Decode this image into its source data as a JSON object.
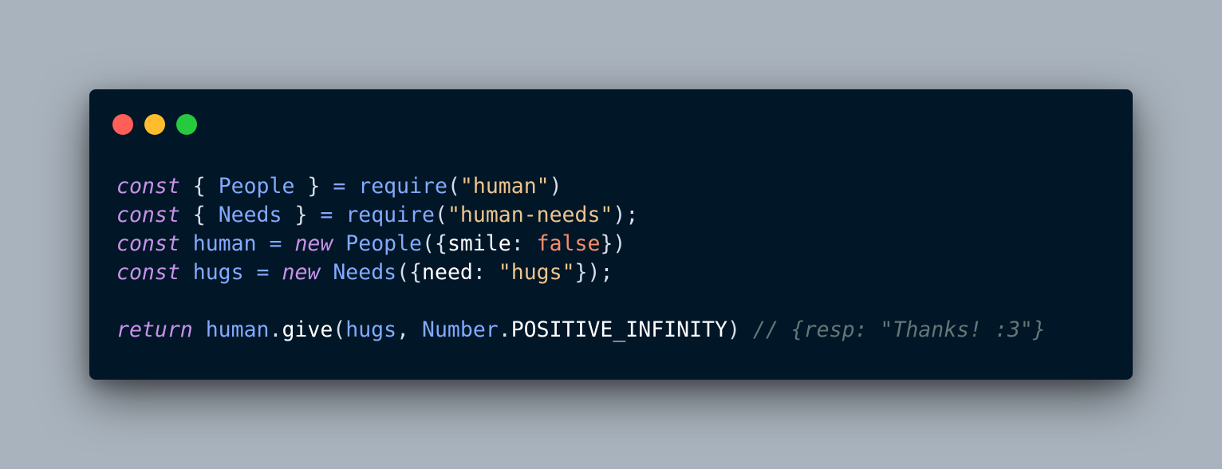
{
  "window": {
    "background": "#011627",
    "controls": [
      {
        "name": "close",
        "color": "#ff5f56"
      },
      {
        "name": "minimize",
        "color": "#ffbd2e"
      },
      {
        "name": "maximize",
        "color": "#27c93f"
      }
    ]
  },
  "code": {
    "l1": {
      "kw": "const",
      "open": "{",
      "name": "People",
      "close": "}",
      "eq": "=",
      "fn": "require",
      "lp": "(",
      "str": "\"human\"",
      "rp": ")"
    },
    "l2": {
      "kw": "const",
      "open": "{",
      "name": "Needs",
      "close": "}",
      "eq": "=",
      "fn": "require",
      "lp": "(",
      "str": "\"human-needs\"",
      "rp": ");"
    },
    "l3": {
      "kw": "const",
      "name": "human",
      "eq": "=",
      "new": "new",
      "cls": "People",
      "lp": "({",
      "key": "smile",
      "colon": ":",
      "val": "false",
      "rp": "})"
    },
    "l4": {
      "kw": "const",
      "name": "hugs",
      "eq": "=",
      "new": "new",
      "cls": "Needs",
      "lp": "({",
      "key": "need",
      "colon": ":",
      "val": "\"hugs\"",
      "rp": "});"
    },
    "l6": {
      "kw": "return",
      "obj": "human",
      "dot": ".",
      "method": "give",
      "lp": "(",
      "arg1": "hugs",
      "comma": ",",
      "ns": "Number",
      "dot2": ".",
      "const": "POSITIVE_INFINITY",
      "rp": ")",
      "comment": "// {resp: \"Thanks! :3\"}"
    }
  }
}
